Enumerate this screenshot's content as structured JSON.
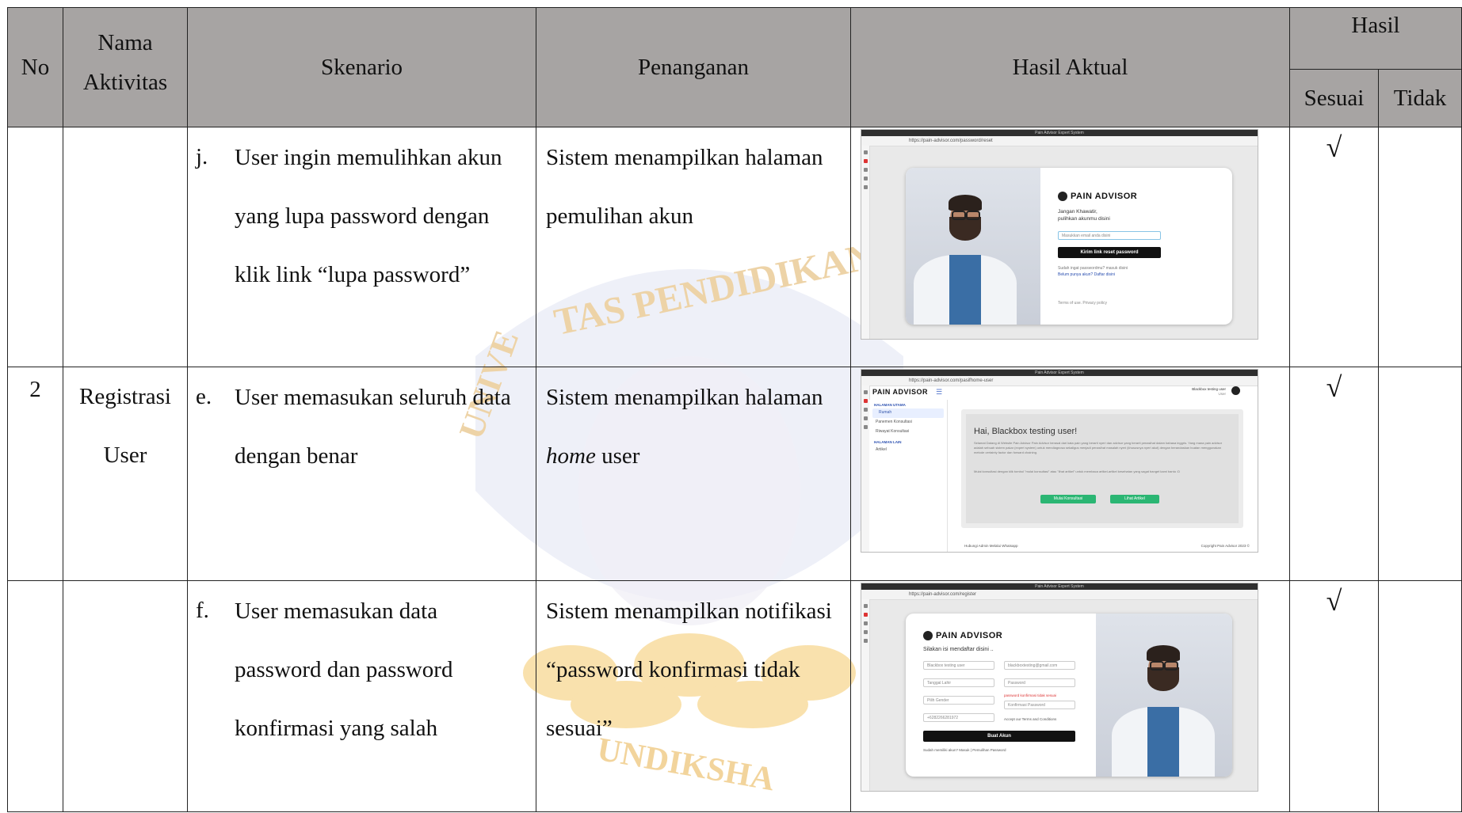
{
  "headers": {
    "no": "No",
    "activity_line1": "Nama",
    "activity_line2": "Aktivitas",
    "scenario": "Skenario",
    "handling": "Penanganan",
    "actual": "Hasil Aktual",
    "result": "Hasil",
    "match": "Sesuai",
    "nomatch": "Tidak"
  },
  "rows": [
    {
      "no": "",
      "activity_line1": "",
      "activity_line2": "",
      "letter": "j.",
      "scenario": "User ingin memulihkan akun yang lupa password dengan klik link “lupa password”",
      "handling_before": "Sistem menampilkan halaman pemulihan akun",
      "handling_em": "",
      "handling_after": "",
      "match": "√",
      "nomatch": "",
      "screenshot": {
        "tab_title": "Pain Advisor Expert System",
        "url": "https://pain-advisor.com/password/reset",
        "logo": "PAIN ADVISOR",
        "heading1": "Jangan Khawatir,",
        "heading2": "pulihkan akunmu disini",
        "field": "Masukkan email anda disini",
        "button": "Kirim link reset password",
        "link1": "Sudah ingat passwordmu? masuk disini",
        "link2": "Belum punya akun? Daftar disini",
        "footer": "Terms of use. Privacy policy"
      }
    },
    {
      "no": "2",
      "activity_line1": "Registrasi",
      "activity_line2": "User",
      "letter": "e.",
      "scenario": "User memasukan seluruh data dengan benar",
      "handling_before": "Sistem menampilkan halaman ",
      "handling_em": "home",
      "handling_after": " user",
      "match": "√",
      "nomatch": "",
      "screenshot": {
        "tab_title": "Pain Advisor Expert System",
        "url": "https://pain-advisor.com/pasifhome-user",
        "logo": "PAIN ADVISOR",
        "user": "Blackbox testing user",
        "user_role": "User",
        "menu_head1": "HALAMAN UTAMA",
        "menu": [
          "Rumah",
          "Panemen Konsultasi",
          "Riwayat Konsultasi"
        ],
        "menu_head2": "HALAMAN LAIN",
        "menu2": [
          "Artikel"
        ],
        "greeting": "Hai, Blackbox testing user!",
        "intro": "Selamat Datang di Website Pain Advisor Pain Advisor berasal dari kata pain yang berarti nyeri dan advisor yang berarti penasihat dalam bahasa inggris. Yang mana pain advisor adalah sebuah sistem pakar (expert system) untuk mendiagnosa sekaligus menjadi penasihat masalah nyeri (khususnya nyeri akut) dengan berandaskan buatan menggunakan metode certainty factor dan forward chaining.",
        "note": "Mulai konsultasi dengan klik tombol \"mulai konsultasi\" atau \"lihat artikel\" untuk membaca artikel-artikel kesehatan yang sagat banget kami bantu :D",
        "btn1": "Mulai Konsultasi",
        "btn2": "Lihat Artikel",
        "footer_left": "Hubungi Admin Melalui Whatsapp",
        "footer_right": "Copyright Pain Advisor 2023 ©"
      }
    },
    {
      "no": "",
      "activity_line1": "",
      "activity_line2": "",
      "letter": "f.",
      "scenario": "User memasukan data password dan password konfirmasi yang salah",
      "handling_before": "Sistem menampilkan notifikasi “password konfirmasi tidak sesuai”",
      "handling_em": "",
      "handling_after": "",
      "match": "√",
      "nomatch": "",
      "screenshot": {
        "tab_title": "Pain Advisor Expert System",
        "url": "https://pain-advisor.com/register",
        "logo": "PAIN ADVISOR",
        "heading": "Silakan isi mendaftar disini ..",
        "f_name": "Blackbox testing user",
        "f_email": "blackboxtesting@gmail.com",
        "f_date": "Tanggal Lahir",
        "f_pass": "Password",
        "f_gender": "Pilih Gender",
        "error": "password konfirmasi tidak sesuai",
        "f_confirm": "Konfirmasi Password",
        "f_phone": "+6282266281972",
        "terms": "Accept our Terms and Conditions",
        "button": "Buat Akun",
        "login": "Sudah memiliki akun? Masuk | Pemulihan Password"
      }
    }
  ],
  "watermark": {
    "top": "TAS PENDIDIKAN",
    "left": "UNIVE",
    "bottom": "UNDIKSHA"
  },
  "colors": {
    "header_bg": "#a7a4a3",
    "watermark": "#f2c04a"
  }
}
